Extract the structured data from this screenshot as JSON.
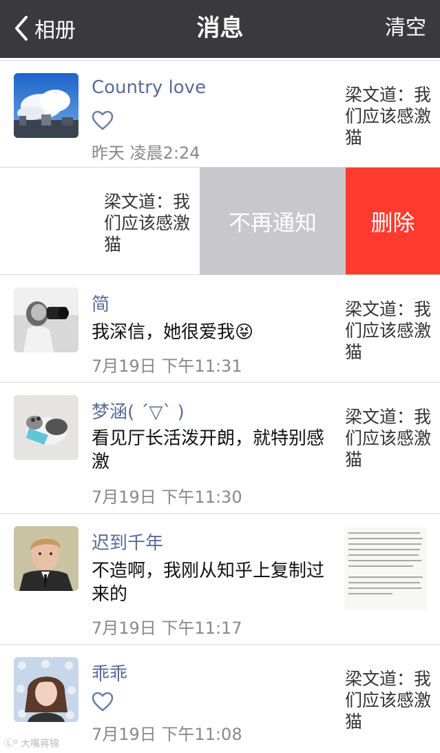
{
  "navbar": {
    "back_label": "相册",
    "title": "消息",
    "clear_label": "清空"
  },
  "rows": [
    {
      "name": "Country love",
      "type": "like",
      "time": "昨天 凌晨2:24",
      "quote": "梁文道：我们应该感激猫"
    },
    {
      "type": "swiped",
      "quote": "梁文道：我们应该感激猫",
      "mute_label": "不再通知",
      "delete_label": "删除"
    },
    {
      "name": "简",
      "type": "comment",
      "message": "我深信，她很爱我😝",
      "time": "7月19日 下午11:31",
      "quote": "梁文道：我们应该感激猫"
    },
    {
      "name": "梦涵( ´▽` )",
      "type": "comment",
      "message": "看见厅长活泼开朗，就特别感激",
      "time": "7月19日 下午11:30",
      "quote": "梁文道：我们应该感激猫"
    },
    {
      "name": "迟到千年",
      "type": "comment",
      "message": "不造啊，我刚从知乎上复制过来的",
      "time": "7月19日 下午11:17",
      "quote_type": "image"
    },
    {
      "name": "乖乖",
      "type": "like",
      "time": "7月19日 下午11:08",
      "quote": "梁文道：我们应该感激猫"
    }
  ],
  "watermark": "Ⓛ⁰ 大嘴蒋锦"
}
